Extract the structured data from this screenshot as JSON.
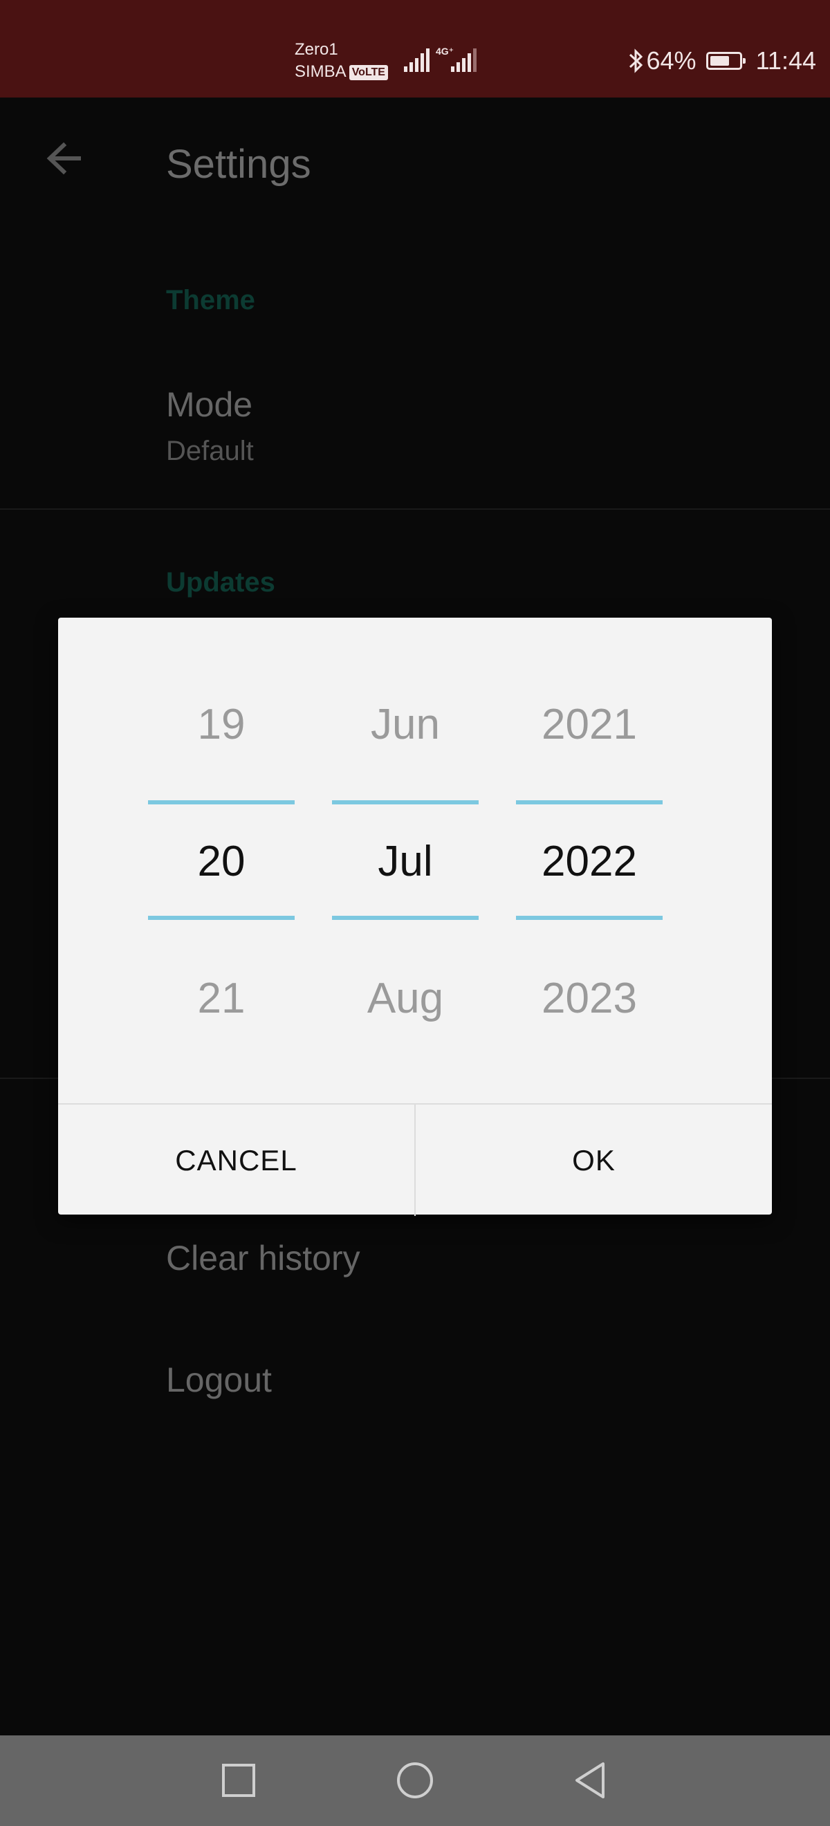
{
  "status_bar": {
    "carrier_line1": "Zero1",
    "carrier_line2": "SIMBA",
    "volte": "VoLTE",
    "network_type": "4G⁺",
    "battery_percent": "64%",
    "time": "11:44",
    "color": "#4a1212"
  },
  "settings": {
    "title": "Settings",
    "section_theme": "Theme",
    "mode_title": "Mode",
    "mode_value": "Default",
    "section_updates": "Updates",
    "clear_history": "Clear history",
    "logout": "Logout",
    "accent_color": "#0c3b32"
  },
  "date_picker": {
    "day": {
      "prev": "19",
      "selected": "20",
      "next": "21"
    },
    "month": {
      "prev": "Jun",
      "selected": "Jul",
      "next": "Aug"
    },
    "year": {
      "prev": "2021",
      "selected": "2022",
      "next": "2023"
    },
    "selection_color": "#7cc8e0",
    "cancel_label": "CANCEL",
    "ok_label": "OK"
  },
  "nav_bar": {
    "recents_icon": "square-recents-icon",
    "home_icon": "circle-home-icon",
    "back_icon": "triangle-back-icon"
  }
}
